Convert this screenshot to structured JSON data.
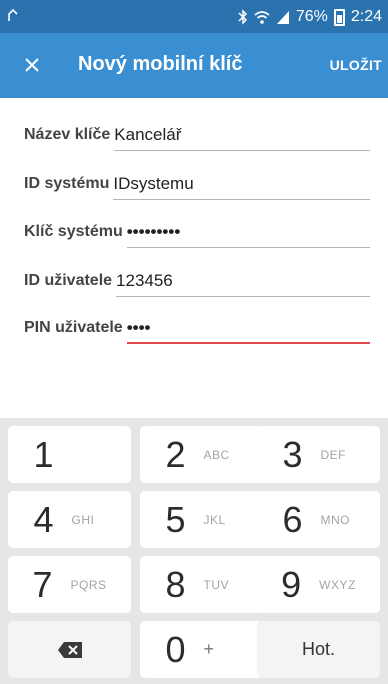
{
  "status_bar": {
    "battery": "76%",
    "time": "2:24"
  },
  "app_bar": {
    "title": "Nový mobilní klíč",
    "save_label": "ULOŽIT"
  },
  "form": {
    "fields": [
      {
        "label": "Název klíče",
        "value": "Kancelář"
      },
      {
        "label": "ID systému",
        "value": "IDsystemu"
      },
      {
        "label": "Klíč systému",
        "value": "•••••••••"
      },
      {
        "label": "ID uživatele",
        "value": "123456"
      },
      {
        "label": "PIN uživatele",
        "value": "••••"
      }
    ]
  },
  "keyboard": {
    "keys": [
      {
        "digit": "1",
        "letters": ""
      },
      {
        "digit": "2",
        "letters": "ABC"
      },
      {
        "digit": "3",
        "letters": "DEF"
      },
      {
        "digit": "4",
        "letters": "GHI"
      },
      {
        "digit": "5",
        "letters": "JKL"
      },
      {
        "digit": "6",
        "letters": "MNO"
      },
      {
        "digit": "7",
        "letters": "PQRS"
      },
      {
        "digit": "8",
        "letters": "TUV"
      },
      {
        "digit": "9",
        "letters": "WXYZ"
      },
      {
        "digit": "0",
        "letters": "+"
      }
    ],
    "done_label": "Hot."
  },
  "colors": {
    "status_bar": "#2a73ae",
    "app_bar": "#3a8fd2",
    "active_underline": "#e0474c"
  },
  "icons": [
    "signal-icon",
    "bluetooth-icon",
    "wifi-icon",
    "cell-signal-icon",
    "battery-icon",
    "close-icon",
    "backspace-icon"
  ]
}
